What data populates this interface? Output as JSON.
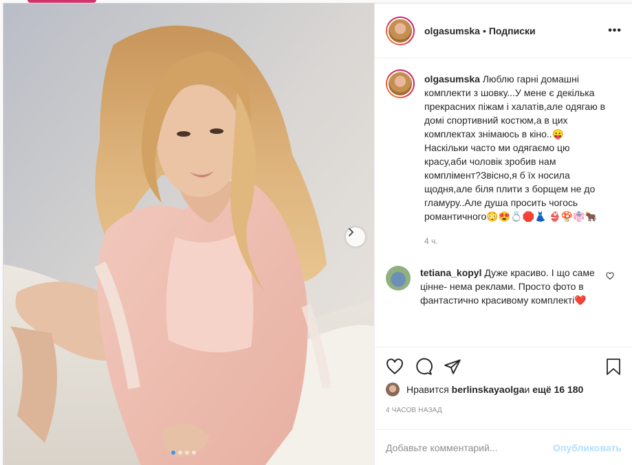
{
  "post": {
    "username": "olgasumska",
    "separator": "•",
    "follow_label": "Подписки",
    "more_label": "•••",
    "caption_user": "olgasumska",
    "caption_text": " Люблю гарні домашні комплекти з шовку...У мене є декілька прекрасних піжам і халатів,але одягаю в домі спортивний костюм,а в цих комплектах знімаюсь в кіно..😛 Наскільки часто ми одягаємо цю красу,аби чоловік зробив нам комплімент?Звісно,я б їх носила щодня,але біля плити з борщем не до гламуру..Але душа просить чогось романтичного😳😍💍🛑👗 👙🍄👘🐂",
    "caption_time": "4 ч.",
    "comments": [
      {
        "user": "tetiana_kopyl",
        "text": " Дуже красиво. І що саме цінне- нема реклами. Просто фото в фантастично красивому комплекті❤️"
      }
    ],
    "likes": {
      "prefix": "Нравится ",
      "user": "berlinskayaolga",
      "middle": " и ",
      "rest": "ещё 16 180"
    },
    "timestamp": "4 ЧАСОВ НАЗАД",
    "add_comment_placeholder": "Добавьте комментарий...",
    "publish_label": "Опубликовать"
  },
  "carousel": {
    "dot_count": 4,
    "active_index": 0
  },
  "colors": {
    "link_blue": "#3897f0",
    "publish_disabled": "#b2dffc",
    "secondary_text": "#8e8e8e"
  },
  "icons": {
    "like": "heart-icon",
    "comment": "comment-bubble-icon",
    "share": "paper-plane-icon",
    "save": "bookmark-icon",
    "next": "chevron-right-icon"
  }
}
